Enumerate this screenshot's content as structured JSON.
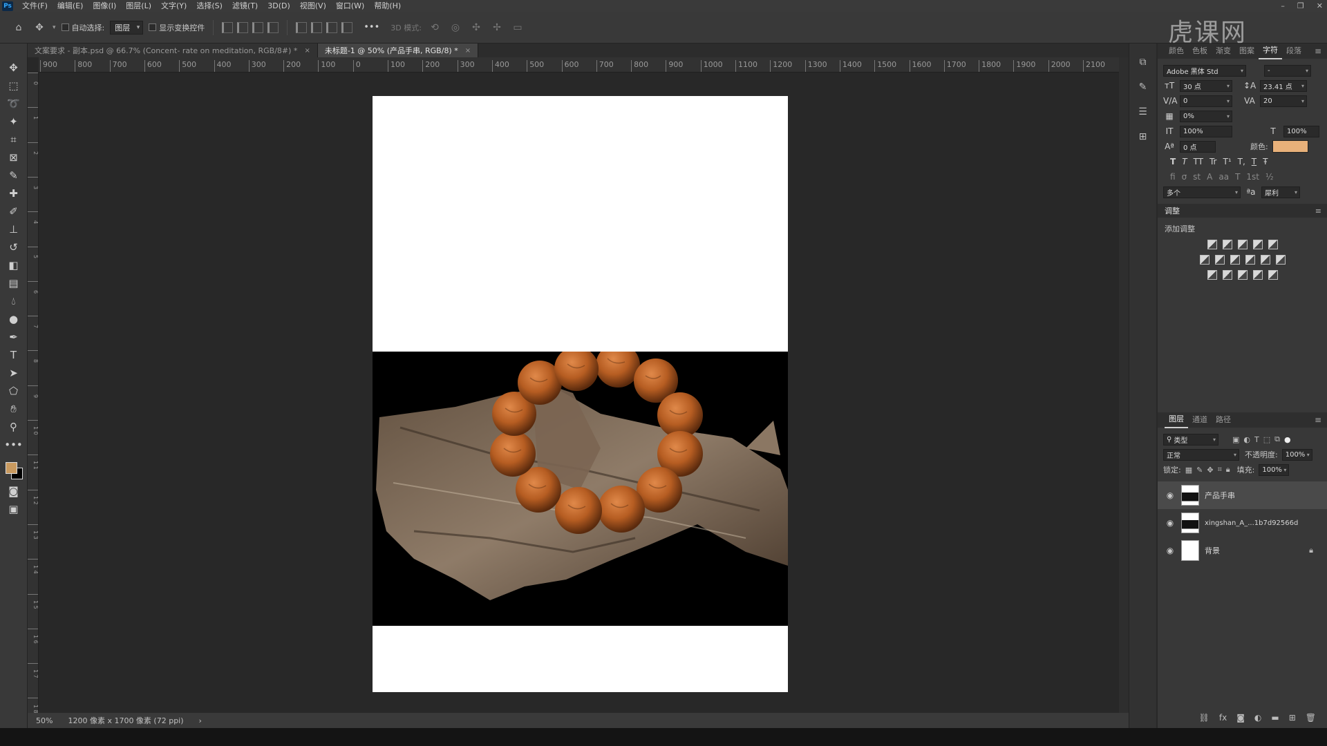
{
  "menubar": {
    "logo": "Ps",
    "items": [
      "文件(F)",
      "编辑(E)",
      "图像(I)",
      "图层(L)",
      "文字(Y)",
      "选择(S)",
      "滤镜(T)",
      "3D(D)",
      "视图(V)",
      "窗口(W)",
      "帮助(H)"
    ],
    "window_controls": [
      "–",
      "❐",
      "✕"
    ]
  },
  "options": {
    "auto_select_label": "自动选择:",
    "auto_select_value": "图层",
    "show_transform_label": "显示变换控件",
    "more": "•••",
    "mode_3d": "3D 模式:",
    "watermark": "虎课网"
  },
  "doc_tabs": [
    {
      "label": "文案要求 - 副本.psd @ 66.7% (Concent- rate on meditation, RGB/8#) *",
      "close": "×"
    },
    {
      "label": "未标题-1 @ 50% (产品手串, RGB/8) *",
      "close": "×"
    }
  ],
  "ruler": {
    "top_ticks": [
      "900",
      "800",
      "700",
      "600",
      "500",
      "400",
      "300",
      "200",
      "100",
      "0",
      "100",
      "200",
      "300",
      "400",
      "500",
      "600",
      "700",
      "800",
      "900",
      "1000",
      "1100",
      "1200",
      "1300",
      "1400",
      "1500",
      "1600",
      "1700",
      "1800",
      "1900",
      "2000",
      "2100"
    ],
    "left_ticks": [
      "0",
      "1",
      "2",
      "3",
      "4",
      "5",
      "6",
      "7",
      "8",
      "9",
      "1 0",
      "1 1",
      "1 2",
      "1 3",
      "1 4",
      "1 5",
      "1 6",
      "1 7",
      "1 8",
      "1 9"
    ]
  },
  "status": {
    "zoom": "50%",
    "doc_size": "1200 像素 x 1700 像素 (72 ppi)",
    "arrow": "›"
  },
  "character_panel": {
    "tabs": [
      "颜色",
      "色板",
      "渐变",
      "图案",
      "字符",
      "段落"
    ],
    "active_tab": "字符",
    "font_family": "Adobe 黑体 Std",
    "font_style": "-",
    "font_size": "30 点",
    "leading": "23.41 点",
    "kerning": "0",
    "tracking": "20",
    "tsume": "0%",
    "vertical_scale": "100%",
    "horizontal_scale": "100%",
    "baseline_shift": "0 点",
    "color_label": "颜色:",
    "text_color": "#e8b17a",
    "style_glyphs": [
      "T",
      "T",
      "TT",
      "Tr",
      "T¹",
      "T,",
      "T",
      "Ŧ"
    ],
    "opentype_glyphs": [
      "fi",
      "σ",
      "st",
      "A",
      "aa",
      "T",
      "1st",
      "½"
    ],
    "language": "多个",
    "anti_alias": "犀利"
  },
  "adjustments": {
    "title": "调整",
    "add_label": "添加调整"
  },
  "layers_panel": {
    "tabs": [
      "图层",
      "通道",
      "路径"
    ],
    "active_tab": "图层",
    "filter_kind": "类型",
    "blend_mode": "正常",
    "opacity_label": "不透明度:",
    "opacity_value": "100%",
    "lock_label": "锁定:",
    "fill_label": "填充:",
    "fill_value": "100%",
    "layers": [
      {
        "name": "产品手串",
        "selected": true
      },
      {
        "name": "xingshan_A_...1b7d92566d",
        "selected": false
      },
      {
        "name": "背景",
        "selected": false,
        "locked": true
      }
    ]
  },
  "colors": {
    "foreground": "#c99a5f",
    "background": "#000000"
  }
}
